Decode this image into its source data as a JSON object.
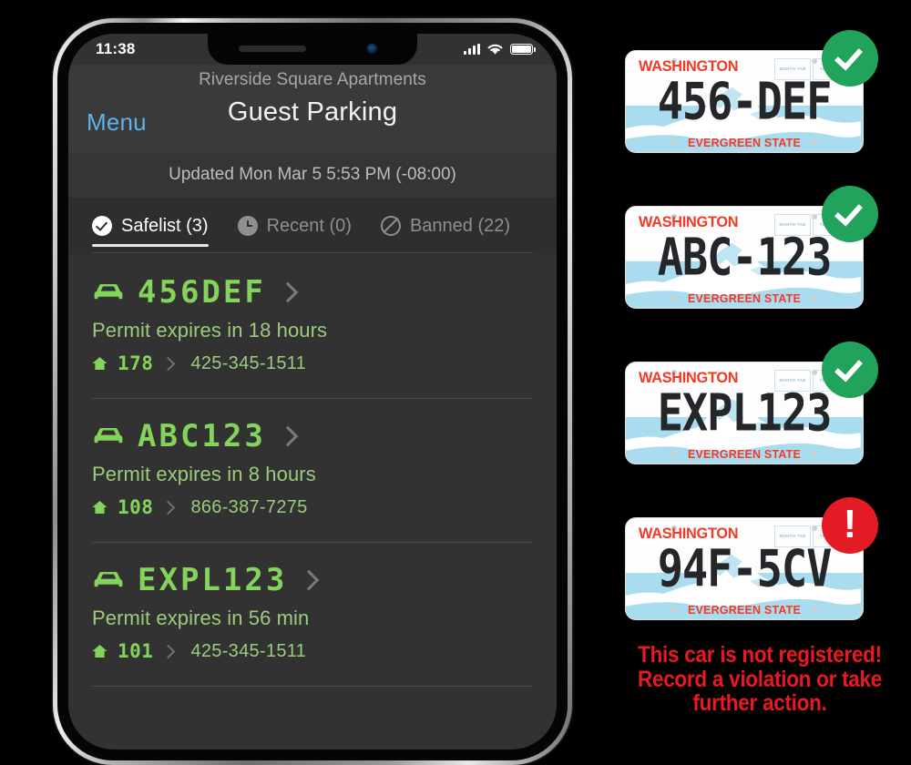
{
  "phone": {
    "status_bar": {
      "time": "11:38",
      "signal_icon": "cellular-bars-icon",
      "wifi_icon": "wifi-icon",
      "battery_icon": "battery-full-icon"
    },
    "nav": {
      "menu_label": "Menu",
      "property_name": "Riverside Square Apartments",
      "title": "Guest Parking"
    },
    "updated_text": "Updated Mon Mar 5 5:53 PM (-08:00)",
    "tabs": [
      {
        "label": "Safelist (3)",
        "icon": "check-circle-icon",
        "active": true
      },
      {
        "label": "Recent (0)",
        "icon": "clock-icon",
        "active": false
      },
      {
        "label": "Banned (22)",
        "icon": "ban-icon",
        "active": false
      }
    ],
    "entries": [
      {
        "plate": "456DEF",
        "expires": "Permit expires in 18 hours",
        "unit": "178",
        "phone": "425-345-1511"
      },
      {
        "plate": "ABC123",
        "expires": "Permit expires in 8 hours",
        "unit": "108",
        "phone": "866-387-7275"
      },
      {
        "plate": "EXPL123",
        "expires": "Permit expires in 56 min",
        "unit": "101",
        "phone": "425-345-1511"
      }
    ]
  },
  "plates": [
    {
      "state": "WASHINGTON",
      "number": "456-DEF",
      "slogan": "EVERGREEN STATE",
      "month_tab": "MONTH TAB",
      "year_tab": "YEAR TAB",
      "status": "ok",
      "badge_icon": "check-circle-icon"
    },
    {
      "state": "WASHINGTON",
      "number": "ABC-123",
      "slogan": "EVERGREEN STATE",
      "month_tab": "MONTH TAB",
      "year_tab": "YEAR TAB",
      "status": "ok",
      "badge_icon": "check-circle-icon"
    },
    {
      "state": "WASHINGTON",
      "number": "EXPL123",
      "slogan": "EVERGREEN STATE",
      "month_tab": "MONTH TAB",
      "year_tab": "YEAR TAB",
      "status": "ok",
      "badge_icon": "check-circle-icon"
    },
    {
      "state": "WASHINGTON",
      "number": "94F-5CV",
      "slogan": "EVERGREEN STATE",
      "month_tab": "MONTH TAB",
      "year_tab": "YEAR TAB",
      "status": "error",
      "badge_icon": "alert-circle-icon",
      "badge_glyph": "!"
    }
  ],
  "warning": {
    "line1": "This car is not registered!",
    "line2": "Record a violation or take",
    "line3": "further action."
  },
  "colors": {
    "accent_green": "#84d45c",
    "link_blue": "#5fb2e8",
    "badge_ok": "#22a35c",
    "badge_error": "#e21b24",
    "plate_red": "#f23a26",
    "warning_red": "#e8191f",
    "screen_bg": "#323232"
  }
}
